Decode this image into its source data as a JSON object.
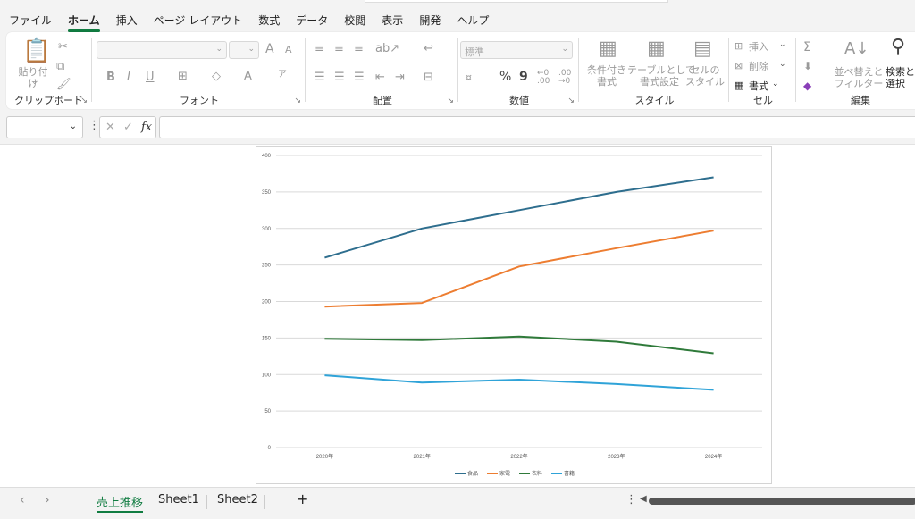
{
  "menu": {
    "tabs": [
      "ファイル",
      "ホーム",
      "挿入",
      "ページ レイアウト",
      "数式",
      "データ",
      "校閲",
      "表示",
      "開発",
      "ヘルプ"
    ],
    "active_index": 1
  },
  "ribbon": {
    "clipboard": {
      "paste": "貼り付け",
      "label": "クリップボード"
    },
    "font": {
      "grow": "A",
      "shrink": "A",
      "bold": "B",
      "italic": "I",
      "underline": "U",
      "label": "フォント"
    },
    "alignment": {
      "label": "配置"
    },
    "number": {
      "format": "標準",
      "percent": "%",
      "comma": "9",
      "label": "数値"
    },
    "styles": {
      "conditional": "条件付き\n書式",
      "table": "テーブルとして\n書式設定",
      "cell": "セルの\nスタイル",
      "label": "スタイル"
    },
    "cells": {
      "insert": "挿入",
      "delete": "削除",
      "format": "書式",
      "label": "セル"
    },
    "editing": {
      "sort": "並べ替えと\nフィルター",
      "find": "検索と\n選択",
      "label": "編集"
    }
  },
  "formula_bar": {
    "fx": "fx",
    "cancel": "✕",
    "enter": "✓"
  },
  "sheets": {
    "tabs": [
      "売上推移",
      "Sheet1",
      "Sheet2"
    ],
    "active_index": 0,
    "add": "+"
  },
  "chart_data": {
    "type": "line",
    "categories": [
      "2020年",
      "2021年",
      "2022年",
      "2023年",
      "2024年"
    ],
    "series": [
      {
        "name": "食品",
        "color": "#2e6e8e",
        "values": [
          260,
          300,
          325,
          350,
          370
        ]
      },
      {
        "name": "家電",
        "color": "#ed7d31",
        "values": [
          193,
          198,
          248,
          273,
          297
        ]
      },
      {
        "name": "衣料",
        "color": "#2f7a3a",
        "values": [
          149,
          147,
          152,
          145,
          129
        ]
      },
      {
        "name": "書籍",
        "color": "#2fa3d8",
        "values": [
          99,
          89,
          93,
          87,
          79
        ]
      }
    ],
    "ylim": [
      0,
      400
    ],
    "yticks": [
      0,
      50,
      100,
      150,
      200,
      250,
      300,
      350,
      400
    ],
    "grid": true,
    "legend": "bottom"
  }
}
